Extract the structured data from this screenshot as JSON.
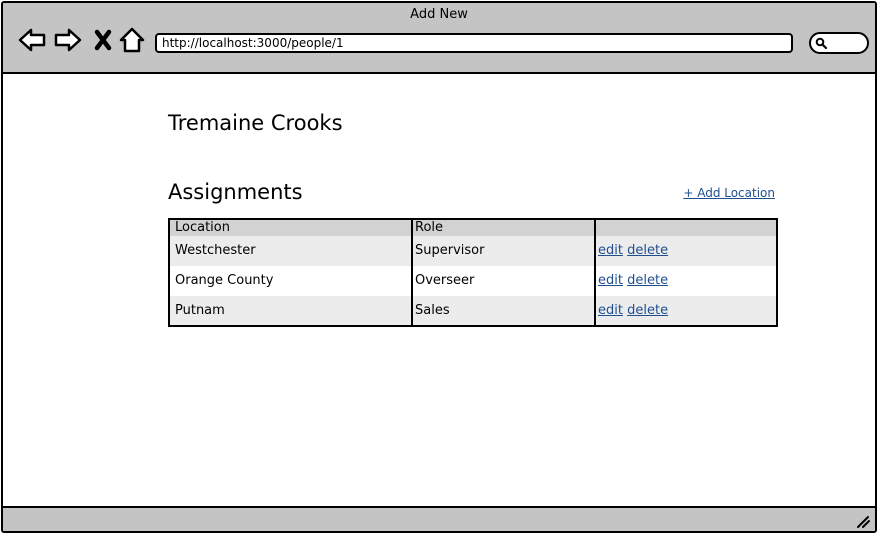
{
  "window": {
    "title": "Add New"
  },
  "toolbar": {
    "back_icon": "back-arrow-icon",
    "forward_icon": "forward-arrow-icon",
    "stop_icon": "close-x-icon",
    "home_icon": "home-icon",
    "url": "http://localhost:3000/people/1",
    "search_icon": "search-icon"
  },
  "page": {
    "person_name": "Tremaine Crooks",
    "section_title": "Assignments",
    "add_location_label": "+ Add Location"
  },
  "table": {
    "headers": [
      "Location",
      "Role",
      ""
    ],
    "rows": [
      {
        "location": "Westchester",
        "role": "Supervisor",
        "edit": "edit",
        "delete": "delete"
      },
      {
        "location": "Orange County",
        "role": "Overseer",
        "edit": "edit",
        "delete": "delete"
      },
      {
        "location": "Putnam",
        "role": "Sales",
        "edit": "edit",
        "delete": "delete"
      }
    ]
  },
  "colors": {
    "chrome_gray": "#c4c4c4",
    "header_row": "#d2d2d2",
    "stripe_row": "#ececec",
    "link_blue": "#1f4f8f"
  }
}
